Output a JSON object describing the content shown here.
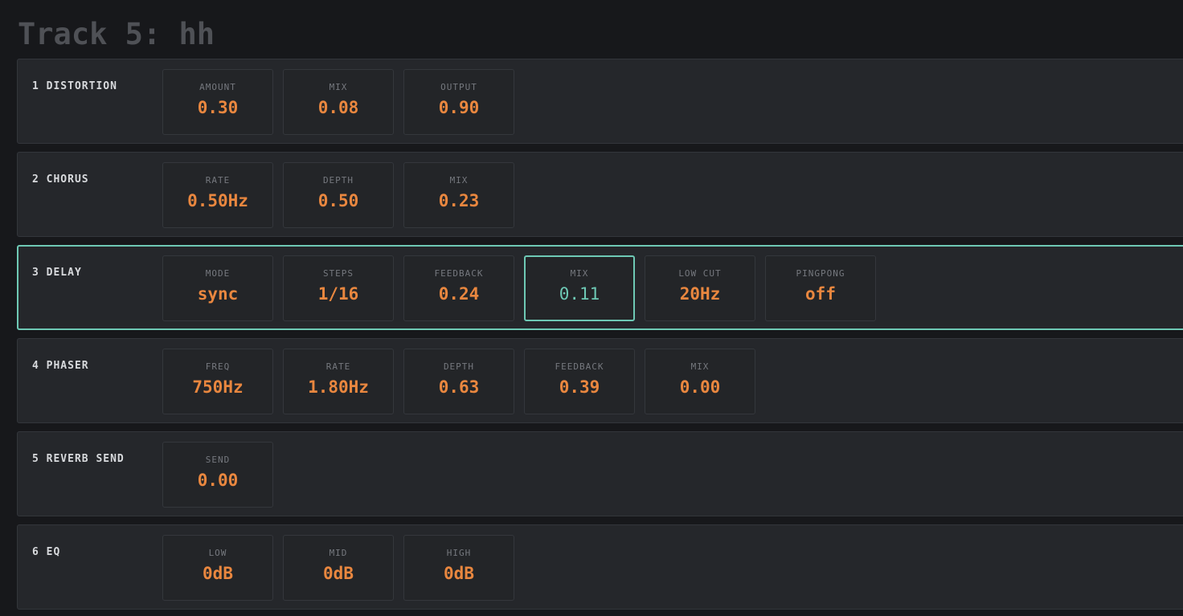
{
  "track": {
    "title": "Track 5: hh"
  },
  "accent_color": "#e9873f",
  "focus_color": "#6ec9b5",
  "effects": [
    {
      "name": "1 DISTORTION",
      "params": [
        {
          "label": "AMOUNT",
          "value": "0.30"
        },
        {
          "label": "MIX",
          "value": "0.08"
        },
        {
          "label": "OUTPUT",
          "value": "0.90"
        }
      ]
    },
    {
      "name": "2 CHORUS",
      "params": [
        {
          "label": "RATE",
          "value": "0.50Hz"
        },
        {
          "label": "DEPTH",
          "value": "0.50"
        },
        {
          "label": "MIX",
          "value": "0.23"
        }
      ]
    },
    {
      "name": "3 DELAY",
      "selected": true,
      "params": [
        {
          "label": "MODE",
          "value": "sync"
        },
        {
          "label": "STEPS",
          "value": "1/16"
        },
        {
          "label": "FEEDBACK",
          "value": "0.24"
        },
        {
          "label": "MIX",
          "value": "0.11",
          "focused": true
        },
        {
          "label": "LOW CUT",
          "value": "20Hz"
        },
        {
          "label": "PINGPONG",
          "value": "off"
        }
      ]
    },
    {
      "name": "4 PHASER",
      "params": [
        {
          "label": "FREQ",
          "value": "750Hz"
        },
        {
          "label": "RATE",
          "value": "1.80Hz"
        },
        {
          "label": "DEPTH",
          "value": "0.63"
        },
        {
          "label": "FEEDBACK",
          "value": "0.39"
        },
        {
          "label": "MIX",
          "value": "0.00"
        }
      ]
    },
    {
      "name": "5 REVERB SEND",
      "params": [
        {
          "label": "SEND",
          "value": "0.00"
        }
      ]
    },
    {
      "name": "6 EQ",
      "params": [
        {
          "label": "LOW",
          "value": "0dB"
        },
        {
          "label": "MID",
          "value": "0dB"
        },
        {
          "label": "HIGH",
          "value": "0dB"
        }
      ]
    }
  ]
}
